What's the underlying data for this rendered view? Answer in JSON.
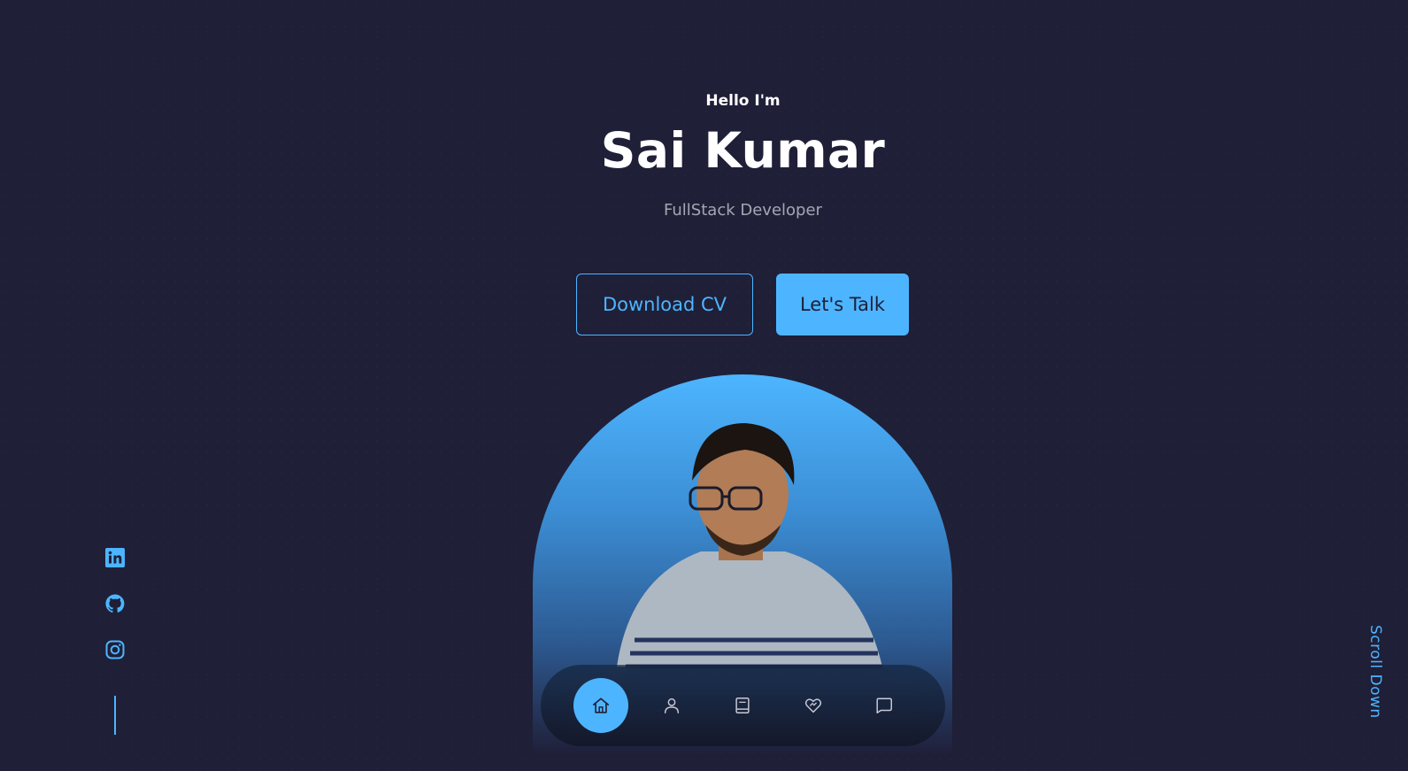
{
  "hero": {
    "greeting": "Hello I'm",
    "name": "Sai Kumar",
    "role": "FullStack Developer"
  },
  "cta": {
    "download_cv": "Download CV",
    "lets_talk": "Let's Talk"
  },
  "socials": [
    "linkedin-icon",
    "github-icon",
    "instagram-icon"
  ],
  "scroll_down": "Scroll Down",
  "nav": {
    "items": [
      "home-icon",
      "user-icon",
      "book-icon",
      "services-icon",
      "message-icon"
    ],
    "active": "home-icon"
  },
  "colors": {
    "background": "#1f1f38",
    "accent": "#4db5ff",
    "text": "#ffffff",
    "muted": "rgba(255,255,255,0.6)"
  }
}
